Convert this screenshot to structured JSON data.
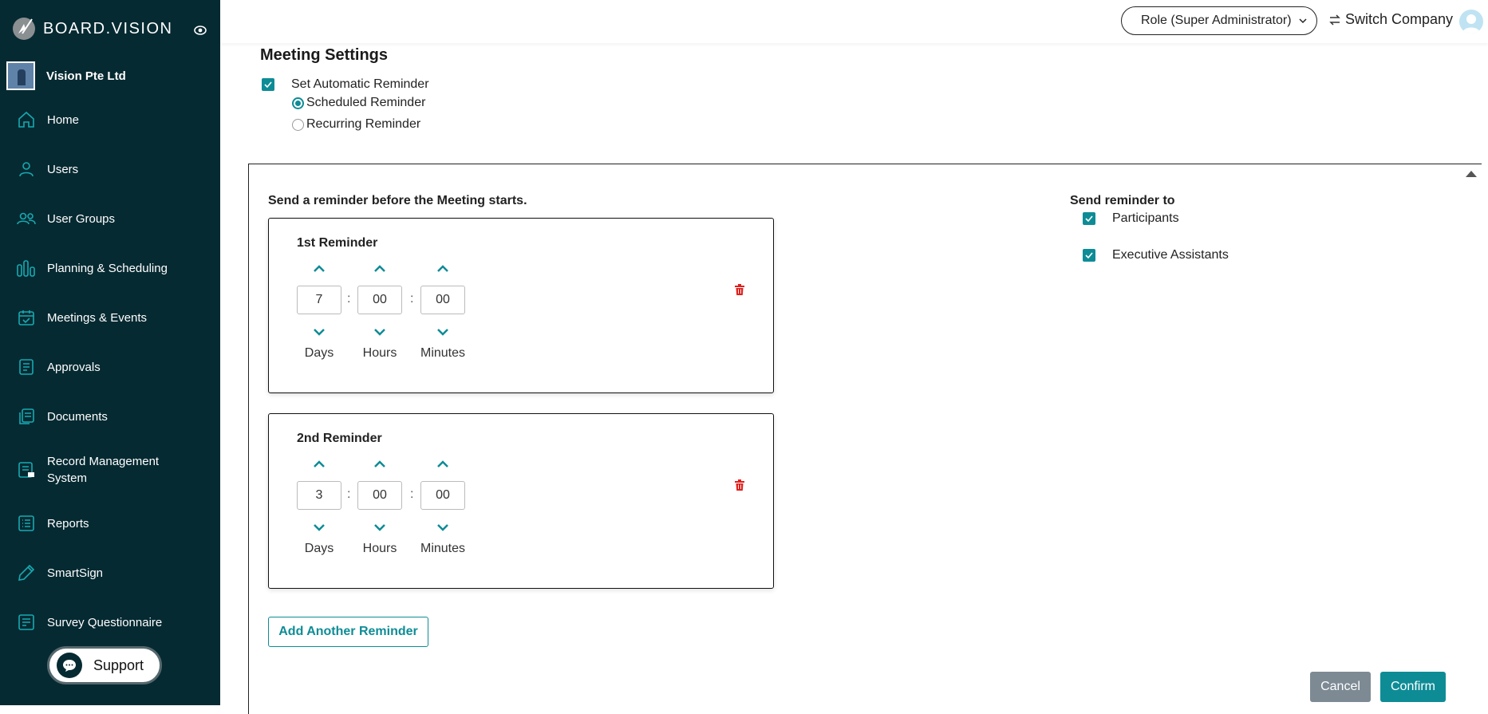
{
  "app": {
    "logo_text": "BOARD.VISION"
  },
  "company": {
    "name": "Vision Pte Ltd"
  },
  "sidebar": {
    "items": [
      {
        "label": "Home",
        "icon": "home-icon"
      },
      {
        "label": "Users",
        "icon": "user-icon"
      },
      {
        "label": "User Groups",
        "icon": "user-group-icon"
      },
      {
        "label": "Planning & Scheduling",
        "icon": "bar-chart-icon"
      },
      {
        "label": "Meetings & Events",
        "icon": "calendar-check-icon"
      },
      {
        "label": "Approvals",
        "icon": "approval-document-icon"
      },
      {
        "label": "Documents",
        "icon": "documents-icon"
      },
      {
        "label": "Record Management System",
        "icon": "record-management-icon"
      },
      {
        "label": "Reports",
        "icon": "report-list-icon"
      },
      {
        "label": "SmartSign",
        "icon": "pen-icon"
      },
      {
        "label": "Survey Questionnaire",
        "icon": "survey-icon"
      }
    ],
    "support_label": "Support"
  },
  "header": {
    "role_label": "Role (Super Administrator)",
    "switch_company_label": "Switch Company"
  },
  "meeting_settings": {
    "title": "Meeting Settings",
    "auto_reminder_label": "Set Automatic Reminder",
    "auto_reminder_checked": true,
    "reminder_types": [
      {
        "label": "Scheduled Reminder",
        "selected": true
      },
      {
        "label": "Recurring Reminder",
        "selected": false
      }
    ],
    "panel": {
      "heading": "Send a reminder before the Meeting starts.",
      "reminders": [
        {
          "title": "1st Reminder",
          "days": "7",
          "hours": "00",
          "minutes": "00"
        },
        {
          "title": "2nd Reminder",
          "days": "3",
          "hours": "00",
          "minutes": "00"
        }
      ],
      "unit_labels": {
        "days": "Days",
        "hours": "Hours",
        "minutes": "Minutes"
      },
      "separator": ":",
      "add_button": "Add Another Reminder",
      "send_to_heading": "Send reminder to",
      "recipients": [
        {
          "label": "Participants",
          "checked": true
        },
        {
          "label": "Executive Assistants",
          "checked": true
        }
      ],
      "cancel_button": "Cancel",
      "confirm_button": "Confirm"
    }
  },
  "colors": {
    "sidebar_bg": "#062a32",
    "accent": "#0e8c96",
    "danger": "#e0201c",
    "cancel_bg": "#7d8a94"
  }
}
